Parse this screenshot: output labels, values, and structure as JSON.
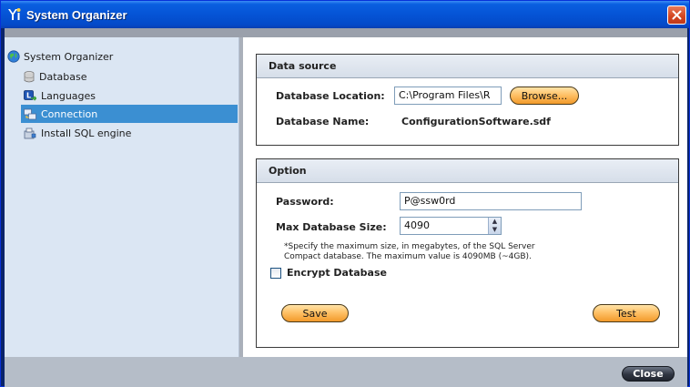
{
  "window": {
    "title": "System Organizer"
  },
  "sidebar": {
    "root": {
      "label": "System Organizer",
      "icon": "globe-icon"
    },
    "items": [
      {
        "label": "Database",
        "icon": "database-icon",
        "selected": false
      },
      {
        "label": "Languages",
        "icon": "languages-icon",
        "selected": false
      },
      {
        "label": "Connection",
        "icon": "connection-icon",
        "selected": true
      },
      {
        "label": "Install SQL engine",
        "icon": "install-icon",
        "selected": false
      }
    ]
  },
  "data_source": {
    "header": "Data source",
    "location_label": "Database Location:",
    "location_value": "C:\\Program Files\\R",
    "browse_label": "Browse...",
    "name_label": "Database Name:",
    "name_value": "ConfigurationSoftware.sdf"
  },
  "option": {
    "header": "Option",
    "password_label": "Password:",
    "password_value": "P@ssw0rd",
    "max_size_label": "Max Database Size:",
    "max_size_value": "4090",
    "note_line1": "*Specify the maximum size, in megabytes, of the SQL Server",
    "note_line2": "Compact database. The maximum value is 4090MB (~4GB).",
    "encrypt_label": "Encrypt Database",
    "encrypt_checked": false,
    "save_label": "Save",
    "test_label": "Test"
  },
  "footer": {
    "close_label": "Close"
  },
  "colors": {
    "titlebar": "#0554d6",
    "selection": "#3b8fd2",
    "accent_button": "#ffc268"
  }
}
